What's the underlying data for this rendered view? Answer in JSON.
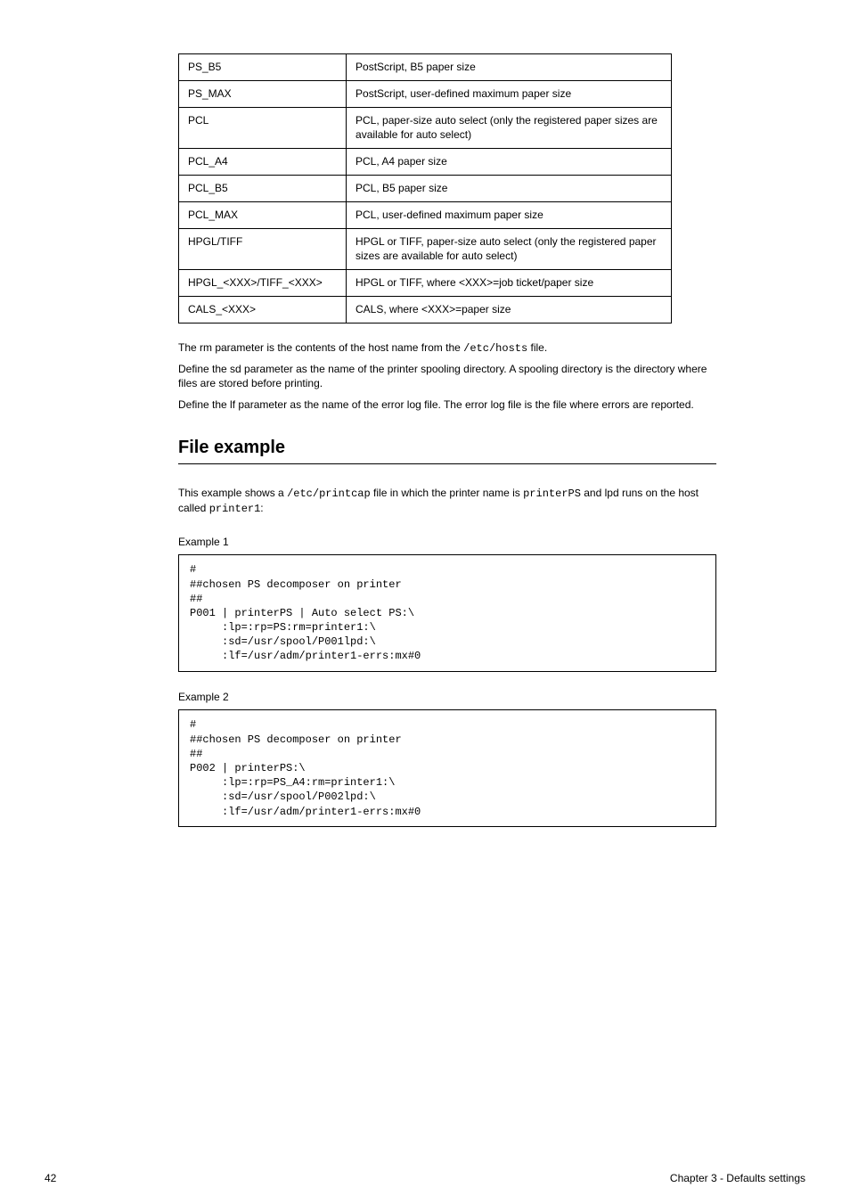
{
  "table": {
    "rows": [
      {
        "left": "PS_B5",
        "right": "PostScript, B5 paper size",
        "tall": false
      },
      {
        "left": "PS_MAX",
        "right": "PostScript, user-defined maximum paper size",
        "tall": false
      },
      {
        "left": "PCL",
        "right": "PCL, paper-size auto select (only the registered paper sizes are available for auto select)",
        "tall": true
      },
      {
        "left": "PCL_A4",
        "right": "PCL, A4 paper size",
        "tall": false
      },
      {
        "left": "PCL_B5",
        "right": "PCL, B5 paper size",
        "tall": false
      },
      {
        "left": "PCL_MAX",
        "right": "PCL, user-defined maximum paper size",
        "tall": false
      },
      {
        "left": "HPGL/TIFF",
        "right": "HPGL or TIFF, paper-size auto select (only the registered paper sizes are available for auto select)",
        "tall": true
      },
      {
        "left": "HPGL_<XXX>/TIFF_<XXX>",
        "right": "HPGL or TIFF, where <XXX>=job ticket/paper size",
        "tall": false
      },
      {
        "left": "CALS_<XXX>",
        "right": "CALS, where <XXX>=paper size",
        "tall": false
      }
    ]
  },
  "para_after_table_1": "The rm parameter is the contents of the host name from the ",
  "para_after_table_1b": " file.",
  "hosts_path": "/etc/hosts",
  "para_sd": "Define the sd parameter as the name of the printer spooling directory. A spooling directory is the directory where files are stored before printing.",
  "para_lf": "Define the lf parameter as the name of the error log file. The error log file is the file where errors are reported.",
  "section_title": "File example",
  "intro": "This example shows a ",
  "intro_b": " file in which the printer name is ",
  "intro_c": " and lpd runs on the host called ",
  "intro_end": ":",
  "printcap_path": "/etc/printcap",
  "printer_name": "printerPS",
  "host_name": "printer1",
  "example1_label": "Example 1",
  "code1": "#\n##chosen PS decomposer on printer\n##\nP001 | printerPS | Auto select PS:\\\n     :lp=:rp=PS:rm=printer1:\\\n     :sd=/usr/spool/P001lpd:\\\n     :lf=/usr/adm/printer1-errs:mx#0",
  "example2_label": "Example 2",
  "code2": "#\n##chosen PS decomposer on printer\n##\nP002 | printerPS:\\\n     :lp=:rp=PS_A4:rm=printer1:\\\n     :sd=/usr/spool/P002lpd:\\\n     :lf=/usr/adm/printer1-errs:mx#0",
  "footer_left": "42",
  "footer_right": "Chapter 3 - Defaults settings"
}
